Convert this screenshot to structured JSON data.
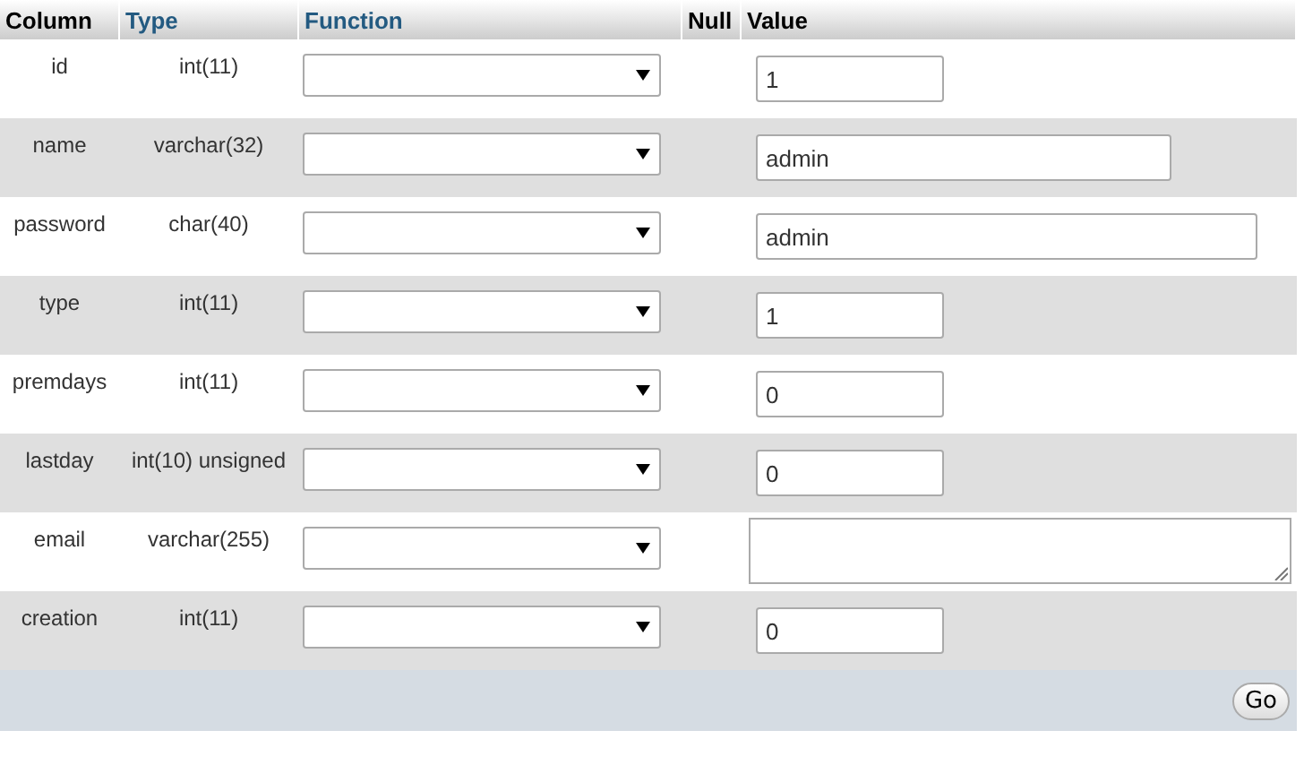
{
  "columns": [
    {
      "label": "Column",
      "link": false
    },
    {
      "label": "Type",
      "link": true
    },
    {
      "label": "Function",
      "link": true
    },
    {
      "label": "Null",
      "link": false
    },
    {
      "label": "Value",
      "link": false
    }
  ],
  "rows": [
    {
      "column": "id",
      "type": "int(11)",
      "kind": "small",
      "value": "1"
    },
    {
      "column": "name",
      "type": "varchar(32)",
      "kind": "medium",
      "value": "admin"
    },
    {
      "column": "password",
      "type": "char(40)",
      "kind": "large",
      "value": "admin"
    },
    {
      "column": "type",
      "type": "int(11)",
      "kind": "small",
      "value": "1"
    },
    {
      "column": "premdays",
      "type": "int(11)",
      "kind": "small",
      "value": "0"
    },
    {
      "column": "lastday",
      "type": "int(10) unsigned",
      "kind": "small",
      "value": "0"
    },
    {
      "column": "email",
      "type": "varchar(255)",
      "kind": "textarea"
    },
    {
      "column": "creation",
      "type": "int(11)",
      "kind": "small",
      "value": "0"
    }
  ],
  "submit": "Go"
}
